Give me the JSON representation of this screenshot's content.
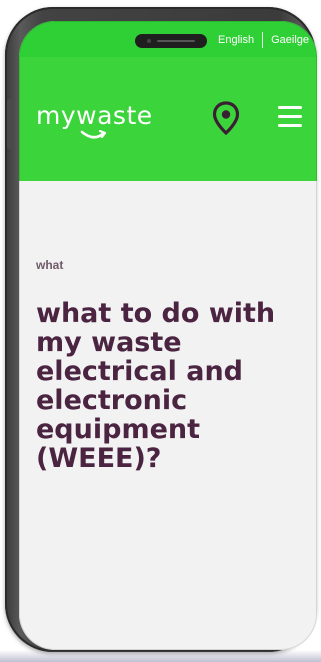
{
  "language_bar": {
    "options": [
      "English",
      "Gaeilge"
    ]
  },
  "header": {
    "logo_text": "mywaste",
    "location_icon": "location-pin-icon",
    "menu_icon": "hamburger-menu-icon"
  },
  "content": {
    "eyebrow": "what",
    "headline": "what to do with my waste electrical and electronic equipment (WEEE)?"
  },
  "colors": {
    "brand_green": "#3bd43a",
    "headline_purple": "#4a2440",
    "eyebrow_grey": "#6f5a68",
    "content_background": "#f2f2f2",
    "phone_frame": "#3f3f3f"
  }
}
